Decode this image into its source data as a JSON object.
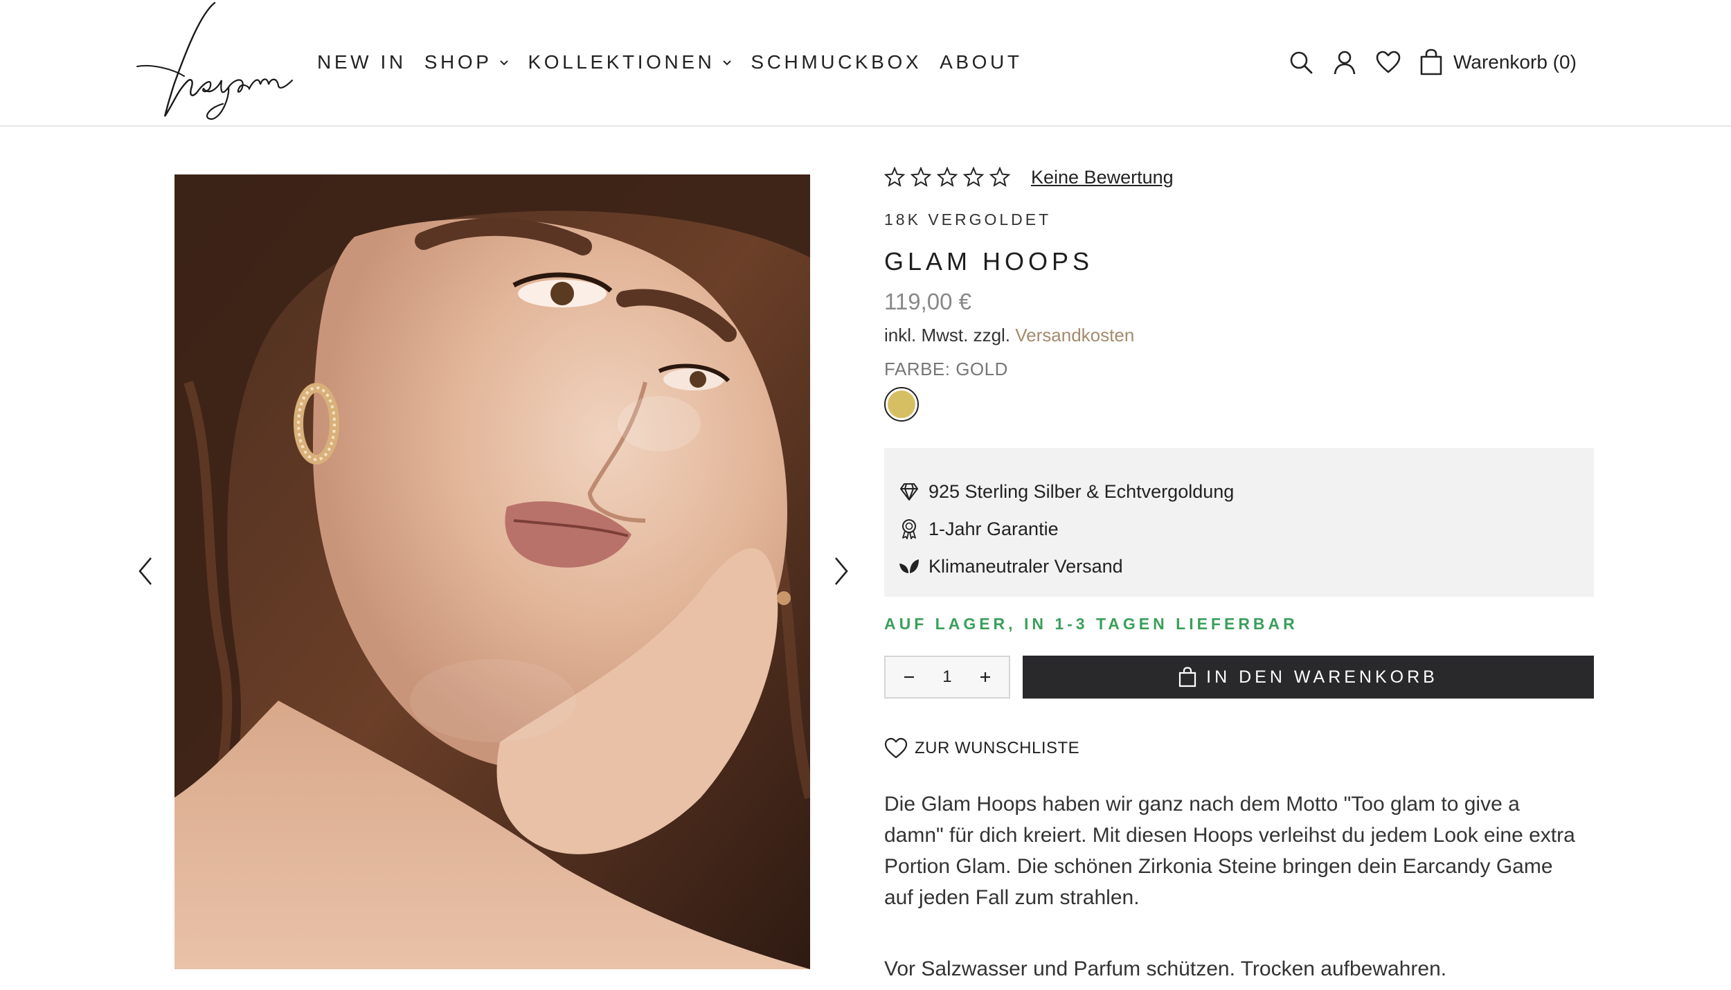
{
  "header": {
    "logo_text": "heyam",
    "nav": [
      {
        "label": "NEW IN",
        "has_dropdown": false
      },
      {
        "label": "SHOP",
        "has_dropdown": true
      },
      {
        "label": "KOLLEKTIONEN",
        "has_dropdown": true
      },
      {
        "label": "SCHMUCKBOX",
        "has_dropdown": false
      },
      {
        "label": "ABOUT",
        "has_dropdown": false
      }
    ],
    "icons": [
      "search-icon",
      "account-icon",
      "wishlist-icon",
      "cart-icon"
    ],
    "cart_label": "Warenkorb (0)"
  },
  "gallery": {
    "image_alt": "Model wearing gold hoop earrings",
    "prev_icon": "chevron-left-icon",
    "next_icon": "chevron-right-icon"
  },
  "product": {
    "rating_stars": 0,
    "rating_max": 5,
    "review_link": "Keine Bewertung",
    "subtitle": "18K VERGOLDET",
    "title": "GLAM HOOPS",
    "price": "119,00 €",
    "tax_prefix": "inkl. Mwst. zzgl.",
    "shipping_link": "Versandkosten",
    "color_label": "FARBE: GOLD",
    "swatch_color": "#d6bf63",
    "features": [
      {
        "icon": "diamond-icon",
        "text": "925 Sterling Silber & Echtvergoldung"
      },
      {
        "icon": "award-icon",
        "text": "1-Jahr Garantie"
      },
      {
        "icon": "leaf-icon",
        "text": "Klimaneutraler Versand"
      }
    ],
    "stock": "AUF LAGER, IN 1-3 TAGEN LIEFERBAR",
    "quantity": "1",
    "add_to_cart": "IN DEN WARENKORB",
    "wishlist": "ZUR WUNSCHLISTE",
    "description": "Die Glam Hoops haben wir ganz nach dem Motto \"Too glam to give a damn\" für dich kreiert. Mit diesen Hoops verleihst du jedem Look eine extra Portion Glam. Die schönen Zirkonia Steine bringen dein Earcandy Game auf jeden Fall zum strahlen.",
    "care": "Vor Salzwasser und Parfum schützen. Trocken aufbewahren."
  },
  "colors": {
    "accent_dark": "#29292c",
    "stock_green": "#3a9f5a",
    "shipping_link": "#a48a6d",
    "feature_bg": "#f2f2f2"
  }
}
